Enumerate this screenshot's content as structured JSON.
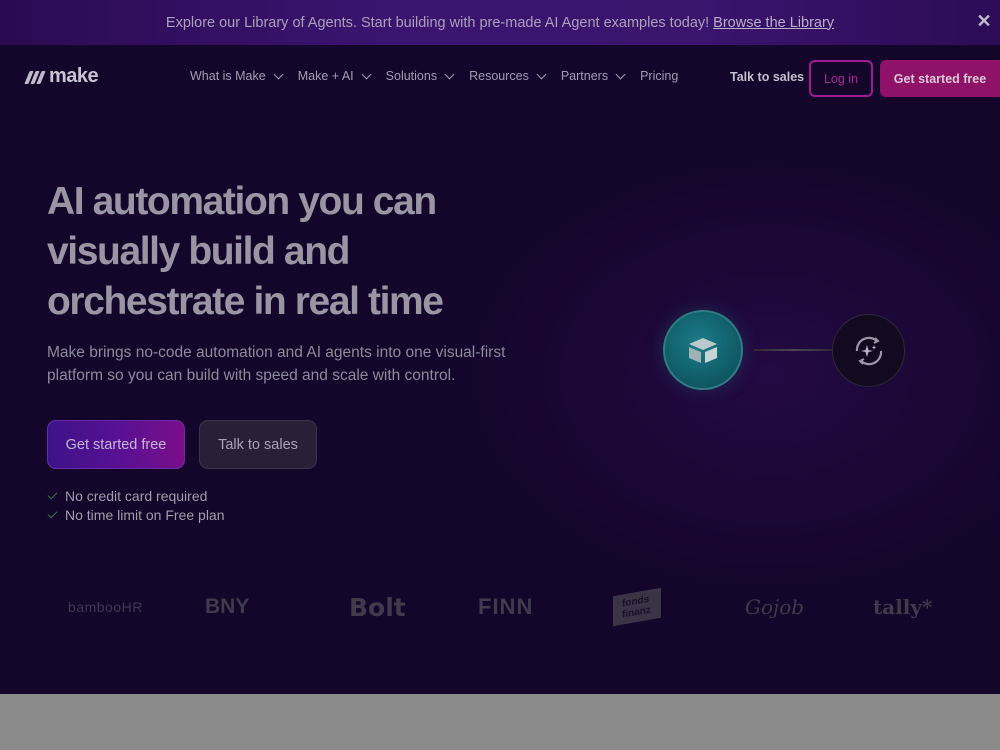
{
  "banner": {
    "text": "Explore our Library of Agents. Start building with pre-made AI Agent examples today!",
    "link": "Browse the Library",
    "close": "✕"
  },
  "nav": {
    "logo": "make",
    "items": [
      {
        "label": "What is Make",
        "dropdown": true
      },
      {
        "label": "Make + AI",
        "dropdown": true
      },
      {
        "label": "Solutions",
        "dropdown": true
      },
      {
        "label": "Resources",
        "dropdown": true
      },
      {
        "label": "Partners",
        "dropdown": true
      },
      {
        "label": "Pricing",
        "dropdown": false
      }
    ],
    "talk_to_sales": "Talk to sales",
    "login": "Log in",
    "get_started": "Get started free"
  },
  "hero": {
    "title_lines": [
      "AI automation you can",
      "visually build and",
      "orchestrate in real time"
    ],
    "subtitle": "Make brings no-code automation and AI agents into one visual-first platform so you can build with speed and scale with control.",
    "primary_button": "Get started free",
    "secondary_button": "Talk to sales",
    "checks": [
      "No credit card required",
      "No time limit on Free plan"
    ]
  },
  "diagram": {
    "node_a_icon": "airtable-box-icon",
    "node_b_icon": "ai-sparkle-cycle-icon"
  },
  "logos": [
    "bambooHR",
    "BNY",
    "Bolt",
    "FINN",
    "fonds finanz",
    "Gojob",
    "tally*"
  ],
  "colors": {
    "page_bg": "#14052b",
    "banner_bg": "#3b1470",
    "accent_magenta": "#8f1268",
    "accent_purple": "#591193",
    "teal_node": "#11606c"
  }
}
